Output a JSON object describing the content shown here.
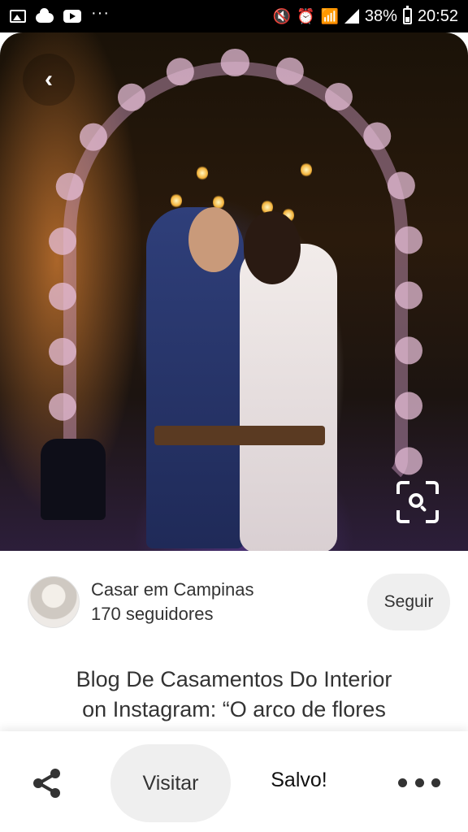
{
  "status_bar": {
    "dots": "···",
    "battery": "38%",
    "time": "20:52",
    "icons": [
      "gallery-icon",
      "cloud-icon",
      "youtube-icon",
      "mute-icon",
      "alarm-icon",
      "wifi-icon",
      "signal-icon",
      "battery-icon"
    ]
  },
  "pin": {
    "image_alt": "Wedding couple on a flower arch swing",
    "back_icon": "‹"
  },
  "profile": {
    "name": "Casar em Campinas",
    "followers": "170 seguidores",
    "follow_label": "Seguir"
  },
  "description": {
    "line1": "Blog De Casamentos Do Interior",
    "line2": "on Instagram: “O arco de flores"
  },
  "actions": {
    "visit_label": "Visitar",
    "saved_label": "Salvo!"
  },
  "colors": {
    "button_bg": "#efefef",
    "text": "#333333"
  }
}
